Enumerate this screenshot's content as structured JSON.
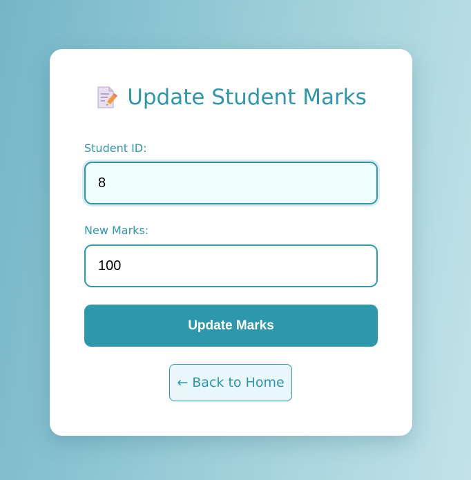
{
  "form": {
    "title": "Update Student Marks",
    "title_icon": "memo-icon",
    "student_id_label": "Student ID:",
    "student_id_value": "8",
    "marks_label": "New Marks:",
    "marks_value": "100",
    "submit_label": "Update Marks",
    "back_label": "← Back to Home"
  },
  "colors": {
    "accent": "#2e97a9",
    "button": "#2d98ab",
    "focused_field_bg": "#f0fefe"
  }
}
